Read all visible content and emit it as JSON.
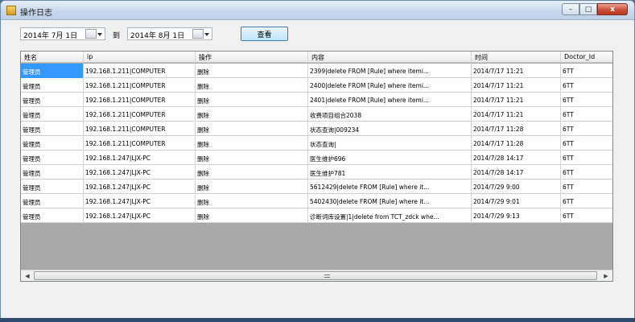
{
  "window": {
    "title": "操作日志",
    "minimize_label": "–",
    "maximize_label": "□",
    "close_label": "x"
  },
  "filter": {
    "start_date": "2014年 7月 1日",
    "to_label": "到",
    "end_date": "2014年 8月 1日",
    "query_label": "查看"
  },
  "grid": {
    "columns": [
      "姓名",
      "ip",
      "操作",
      "内容",
      "时间",
      "Doctor_Id"
    ],
    "rows": [
      [
        "管理员",
        "192.168.1.211|COMPUTER",
        "删除",
        "2399|delete   FROM  [Rule] where itemi...",
        "2014/7/17 11:21",
        "6TT"
      ],
      [
        "管理员",
        "192.168.1.211|COMPUTER",
        "删除",
        "2400|delete   FROM  [Rule] where itemi...",
        "2014/7/17 11:21",
        "6TT"
      ],
      [
        "管理员",
        "192.168.1.211|COMPUTER",
        "删除",
        "2401|delete   FROM  [Rule] where itemi...",
        "2014/7/17 11:21",
        "6TT"
      ],
      [
        "管理员",
        "192.168.1.211|COMPUTER",
        "删除",
        "收费项目组合2038",
        "2014/7/17 11:21",
        "6TT"
      ],
      [
        "管理员",
        "192.168.1.211|COMPUTER",
        "删除",
        "状态查询|009234",
        "2014/7/17 11:28",
        "6TT"
      ],
      [
        "管理员",
        "192.168.1.211|COMPUTER",
        "删除",
        "状态查询|",
        "2014/7/17 11:28",
        "6TT"
      ],
      [
        "管理员",
        "192.168.1.247|LJX-PC",
        "删除",
        "医生维护696",
        "2014/7/28 14:17",
        "6TT"
      ],
      [
        "管理员",
        "192.168.1.247|LJX-PC",
        "删除",
        "医生维护781",
        "2014/7/28 14:17",
        "6TT"
      ],
      [
        "管理员",
        "192.168.1.247|LJX-PC",
        "删除",
        "5612429|delete   FROM  [Rule] where it...",
        "2014/7/29 9:00",
        "6TT"
      ],
      [
        "管理员",
        "192.168.1.247|LJX-PC",
        "删除",
        "5402430|delete   FROM  [Rule] where it...",
        "2014/7/29 9:01",
        "6TT"
      ],
      [
        "管理员",
        "192.168.1.247|LJX-PC",
        "删除",
        "诊断词库设置|1|delete from TCT_zdck whe...",
        "2014/7/29 9:13",
        "6TT"
      ]
    ]
  },
  "scrollbar": {
    "left_arrow": "◀",
    "right_arrow": "▶"
  }
}
